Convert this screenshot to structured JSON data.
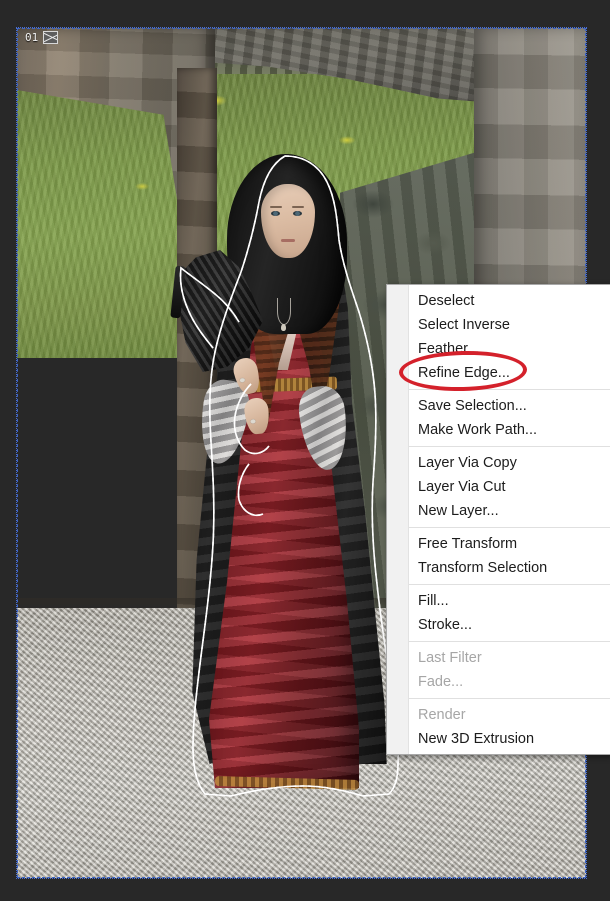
{
  "app": {
    "workspace_background": "#282828",
    "canvas_border_color": "#3c64c8"
  },
  "document_tab": {
    "label": "01",
    "thumbnail_icon": "image-thumbnail-icon"
  },
  "photo": {
    "description": "Woman in a black hooded cloak and red gown standing in a stone archway",
    "subject_selected": true,
    "selection_style": "marching-ants",
    "colors": {
      "grass": "#7d9a49",
      "stone": "#8d7f6c",
      "gravel": "#cbc7bd",
      "cloak": "#1a1a1a",
      "gown": "#8e1d24",
      "skin": "#dcbda4"
    }
  },
  "context_menu": {
    "groups": [
      {
        "items": [
          {
            "label": "Deselect",
            "disabled": false,
            "name": "menu-item-deselect"
          },
          {
            "label": "Select Inverse",
            "disabled": false,
            "name": "menu-item-select-inverse"
          },
          {
            "label": "Feather...",
            "disabled": false,
            "name": "menu-item-feather"
          },
          {
            "label": "Refine Edge...",
            "disabled": false,
            "name": "menu-item-refine-edge"
          }
        ]
      },
      {
        "items": [
          {
            "label": "Save Selection...",
            "disabled": false,
            "name": "menu-item-save-selection"
          },
          {
            "label": "Make Work Path...",
            "disabled": false,
            "name": "menu-item-make-work-path"
          }
        ]
      },
      {
        "items": [
          {
            "label": "Layer Via Copy",
            "disabled": false,
            "name": "menu-item-layer-via-copy"
          },
          {
            "label": "Layer Via Cut",
            "disabled": false,
            "name": "menu-item-layer-via-cut"
          },
          {
            "label": "New Layer...",
            "disabled": false,
            "name": "menu-item-new-layer"
          }
        ]
      },
      {
        "items": [
          {
            "label": "Free Transform",
            "disabled": false,
            "name": "menu-item-free-transform"
          },
          {
            "label": "Transform Selection",
            "disabled": false,
            "name": "menu-item-transform-selection"
          }
        ]
      },
      {
        "items": [
          {
            "label": "Fill...",
            "disabled": false,
            "name": "menu-item-fill"
          },
          {
            "label": "Stroke...",
            "disabled": false,
            "name": "menu-item-stroke"
          }
        ]
      },
      {
        "items": [
          {
            "label": "Last Filter",
            "disabled": true,
            "name": "menu-item-last-filter"
          },
          {
            "label": "Fade...",
            "disabled": true,
            "name": "menu-item-fade"
          }
        ]
      },
      {
        "items": [
          {
            "label": "Render",
            "disabled": true,
            "name": "menu-item-render"
          },
          {
            "label": "New 3D Extrusion",
            "disabled": false,
            "name": "menu-item-new-3d-extrusion"
          }
        ]
      }
    ]
  },
  "annotation": {
    "shape": "ellipse",
    "color": "#d4212b",
    "highlights_item": "Refine Edge..."
  }
}
